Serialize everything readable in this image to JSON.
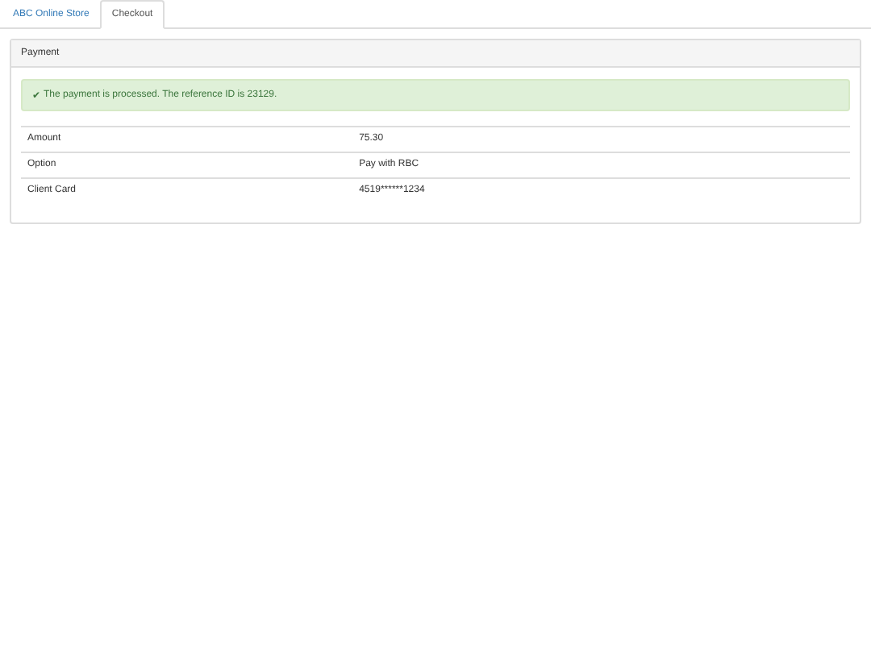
{
  "tabs": [
    {
      "label": "ABC Online Store",
      "selected": false
    },
    {
      "label": "Checkout",
      "selected": true
    }
  ],
  "panel": {
    "title": "Payment",
    "alert": {
      "icon": "✔",
      "message": "The payment is processed. The reference ID is 23129."
    },
    "rows": [
      {
        "label": "Amount",
        "value": "75.30"
      },
      {
        "label": "Option",
        "value": "Pay with RBC"
      },
      {
        "label": "Client Card",
        "value": "4519******1234"
      }
    ]
  }
}
